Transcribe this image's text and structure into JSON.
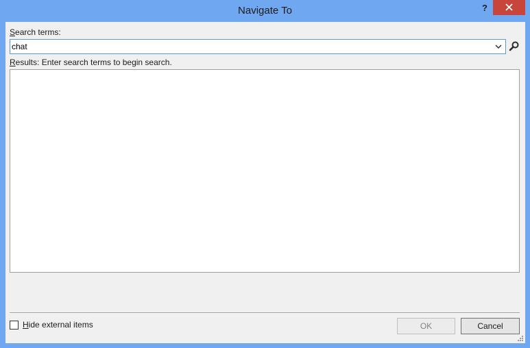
{
  "window": {
    "title": "Navigate To",
    "help_label": "?"
  },
  "search": {
    "label_accel": "S",
    "label_rest": "earch terms:",
    "value": "chat"
  },
  "results": {
    "label_accel": "R",
    "label_rest": "esults: Enter search terms to begin search."
  },
  "options": {
    "hide_external_accel": "H",
    "hide_external_rest": "ide external items",
    "hide_external_checked": false
  },
  "buttons": {
    "ok_label": "OK",
    "cancel_label": "Cancel"
  },
  "colors": {
    "titlebar": "#6fa8f0",
    "close_button": "#c7453b",
    "client_background": "#f0f0f0",
    "focus_border": "#5b9bd5"
  }
}
